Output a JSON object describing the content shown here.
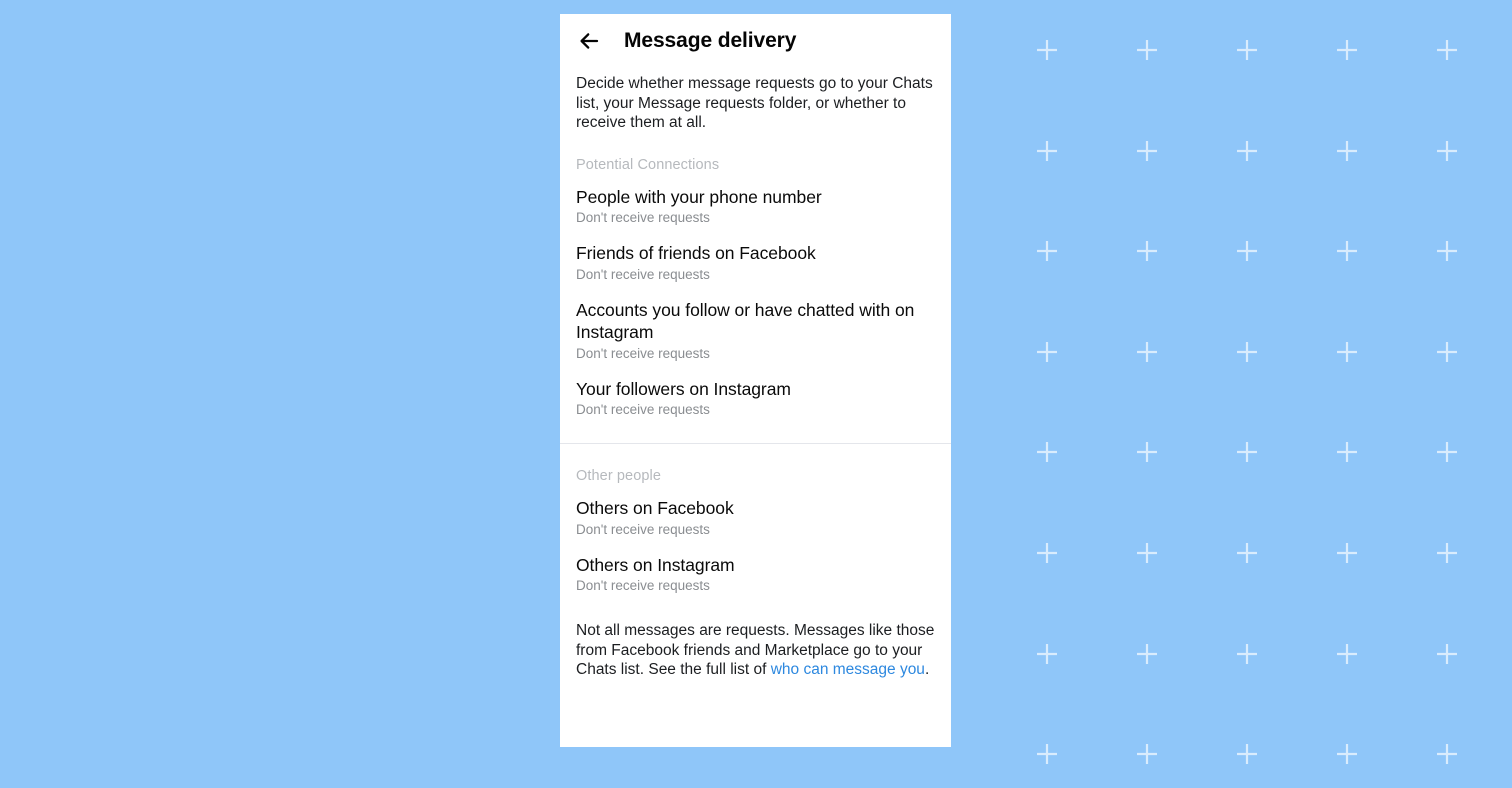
{
  "background": {
    "color": "#8FC6F9",
    "cross_color": "#D9ECFD",
    "pattern_name": "plus-grid"
  },
  "panel": {
    "background": "#FFFFFF",
    "header": {
      "back_icon": "arrow-left-icon",
      "title": "Message delivery"
    },
    "intro": "Decide whether message requests go to your Chats list, your Message requests folder, or whether to receive them at all.",
    "sections": [
      {
        "header": "Potential Connections",
        "rows": [
          {
            "title": "People with your phone number",
            "subtitle": "Don't receive requests"
          },
          {
            "title": "Friends of friends on Facebook",
            "subtitle": "Don't receive requests"
          },
          {
            "title": "Accounts you follow or have chatted with on Instagram",
            "subtitle": "Don't receive requests"
          },
          {
            "title": "Your followers on Instagram",
            "subtitle": "Don't receive requests"
          }
        ]
      },
      {
        "header": "Other people",
        "rows": [
          {
            "title": "Others on Facebook",
            "subtitle": "Don't receive requests"
          },
          {
            "title": "Others on Instagram",
            "subtitle": "Don't receive requests"
          }
        ]
      }
    ],
    "footnote": {
      "text_before": "Not all messages are requests. Messages like those from Facebook friends and Marketplace go to your Chats list. See the full list of ",
      "link_text": "who can message you",
      "text_after": ".",
      "link_color": "#2D88DF"
    }
  }
}
